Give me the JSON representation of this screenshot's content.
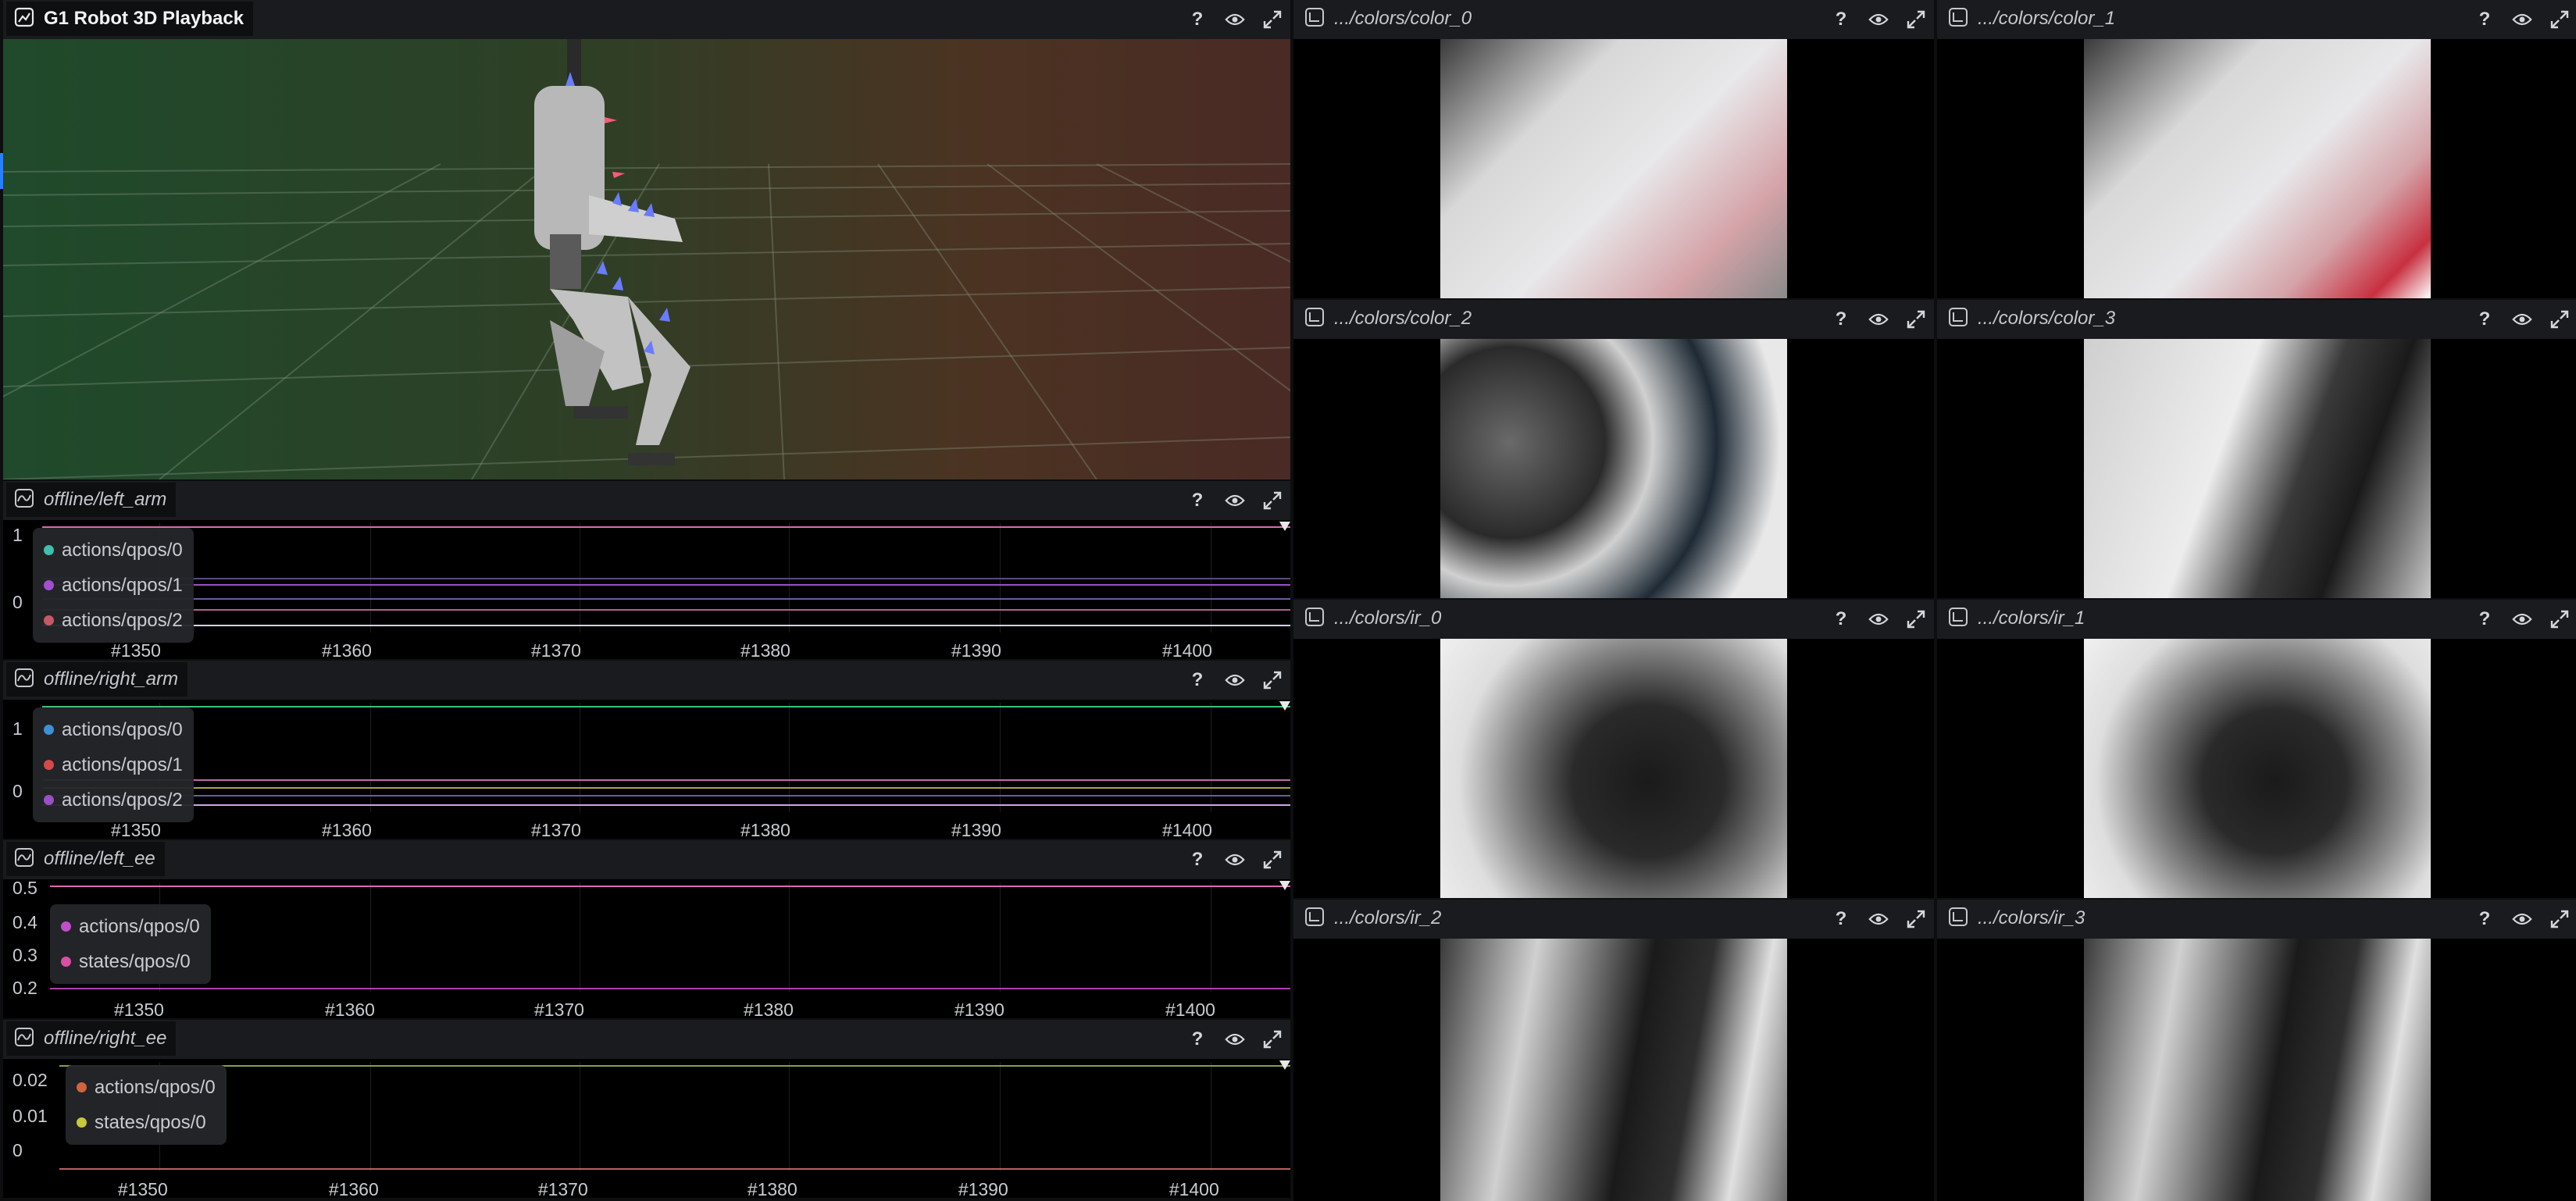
{
  "viewer3d": {
    "title": "G1 Robot 3D Playback",
    "icon": "scene-3d-icon"
  },
  "controls": {
    "help": "?",
    "visibility": "eye-icon",
    "maximize": "expand-icon"
  },
  "plots": [
    {
      "title": "offline/left_arm",
      "y_ticks": [
        "1",
        "0"
      ],
      "x_ticks": [
        "#1350",
        "#1360",
        "#1370",
        "#1380",
        "#1390",
        "#1400"
      ],
      "legend": [
        {
          "label": "actions/qpos/0",
          "color": "#3fbfae"
        },
        {
          "label": "actions/qpos/1",
          "color": "#a24fd0"
        },
        {
          "label": "actions/qpos/2",
          "color": "#c45a66"
        }
      ]
    },
    {
      "title": "offline/right_arm",
      "y_ticks": [
        "1",
        "0"
      ],
      "x_ticks": [
        "#1350",
        "#1360",
        "#1370",
        "#1380",
        "#1390",
        "#1400"
      ],
      "legend": [
        {
          "label": "actions/qpos/0",
          "color": "#3d8fd6"
        },
        {
          "label": "actions/qpos/1",
          "color": "#d34a4a"
        },
        {
          "label": "actions/qpos/2",
          "color": "#9a4fc6"
        }
      ]
    },
    {
      "title": "offline/left_ee",
      "y_ticks": [
        "0.5",
        "0.4",
        "0.3",
        "0.2"
      ],
      "x_ticks": [
        "#1350",
        "#1360",
        "#1370",
        "#1380",
        "#1390",
        "#1400"
      ],
      "legend": [
        {
          "label": "actions/qpos/0",
          "color": "#c04ec9"
        },
        {
          "label": "states/qpos/0",
          "color": "#d94fa6"
        }
      ]
    },
    {
      "title": "offline/right_ee",
      "y_ticks": [
        "0.02",
        "0.01",
        "0"
      ],
      "x_ticks": [
        "#1350",
        "#1360",
        "#1370",
        "#1380",
        "#1390",
        "#1400"
      ],
      "legend": [
        {
          "label": "actions/qpos/0",
          "color": "#d0643f"
        },
        {
          "label": "states/qpos/0",
          "color": "#c8c83a"
        }
      ]
    }
  ],
  "cameras": [
    {
      "title": ".../colors/color_0",
      "kind": "color"
    },
    {
      "title": ".../colors/color_1",
      "kind": "color"
    },
    {
      "title": ".../colors/color_2",
      "kind": "color"
    },
    {
      "title": ".../colors/color_3",
      "kind": "color"
    },
    {
      "title": ".../colors/ir_0",
      "kind": "ir"
    },
    {
      "title": ".../colors/ir_1",
      "kind": "ir"
    },
    {
      "title": ".../colors/ir_2",
      "kind": "ir"
    },
    {
      "title": ".../colors/ir_3",
      "kind": "ir"
    }
  ]
}
